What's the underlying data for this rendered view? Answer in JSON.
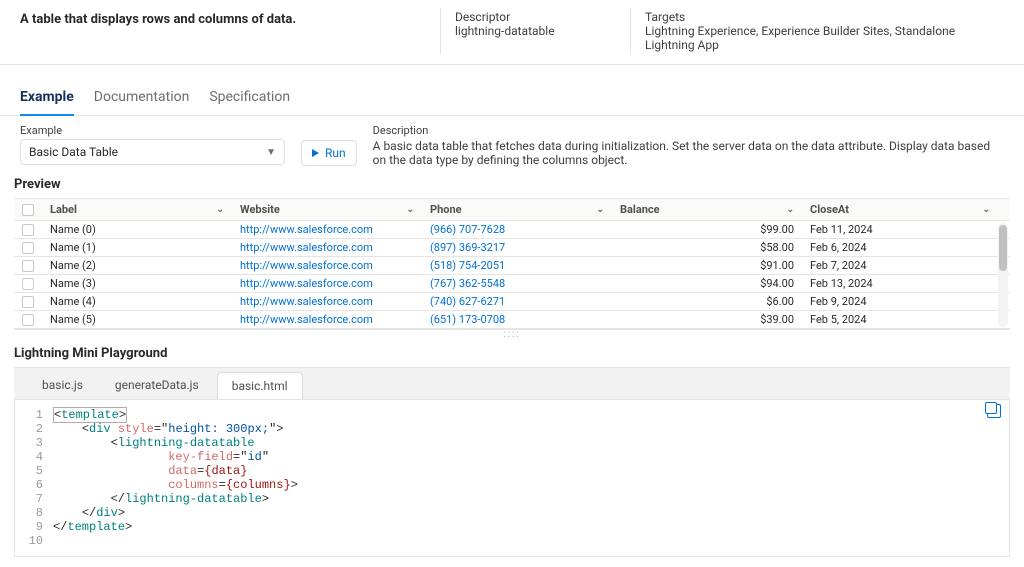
{
  "meta": {
    "summary": "A table that displays rows and columns of data.",
    "descriptor_label": "Descriptor",
    "descriptor_value": "lightning-datatable",
    "targets_label": "Targets",
    "targets_value": "Lightning Experience, Experience Builder Sites, Standalone Lightning App"
  },
  "tabs": {
    "example": "Example",
    "documentation": "Documentation",
    "specification": "Specification"
  },
  "example": {
    "label": "Example",
    "selected": "Basic Data Table",
    "run_label": "Run",
    "desc_label": "Description",
    "desc_text": "A basic data table that fetches data during initialization. Set the server data on the data attribute. Display data based on the data type by defining the columns object."
  },
  "preview_label": "Preview",
  "table": {
    "columns": {
      "label": "Label",
      "website": "Website",
      "phone": "Phone",
      "balance": "Balance",
      "closeat": "CloseAt"
    },
    "rows": [
      {
        "label": "Name (0)",
        "website": "http://www.salesforce.com",
        "phone": "(966) 707-7628",
        "balance": "$99.00",
        "closeat": "Feb 11, 2024"
      },
      {
        "label": "Name (1)",
        "website": "http://www.salesforce.com",
        "phone": "(897) 369-3217",
        "balance": "$58.00",
        "closeat": "Feb 6, 2024"
      },
      {
        "label": "Name (2)",
        "website": "http://www.salesforce.com",
        "phone": "(518) 754-2051",
        "balance": "$91.00",
        "closeat": "Feb 7, 2024"
      },
      {
        "label": "Name (3)",
        "website": "http://www.salesforce.com",
        "phone": "(767) 362-5548",
        "balance": "$94.00",
        "closeat": "Feb 13, 2024"
      },
      {
        "label": "Name (4)",
        "website": "http://www.salesforce.com",
        "phone": "(740) 627-6271",
        "balance": "$6.00",
        "closeat": "Feb 9, 2024"
      },
      {
        "label": "Name (5)",
        "website": "http://www.salesforce.com",
        "phone": "(651) 173-0708",
        "balance": "$39.00",
        "closeat": "Feb 5, 2024"
      }
    ]
  },
  "playground_label": "Lightning Mini Playground",
  "code_tabs": {
    "t0": "basic.js",
    "t1": "generateData.js",
    "t2": "basic.html"
  },
  "code": {
    "l1": {
      "n": "1",
      "a": "<",
      "b": "template",
      "c": ">"
    },
    "l2": {
      "n": "2",
      "indent": "    ",
      "a": "<",
      "b": "div",
      "sp": " ",
      "attr1": "style",
      "eq": "=\"",
      "val1": "height: 300px;",
      "cq": "\">"
    },
    "l3": {
      "n": "3",
      "indent": "        ",
      "a": "<",
      "b": "lightning-datatable"
    },
    "l4": {
      "n": "4",
      "indent": "                ",
      "attr": "key-field",
      "eq": "=\"",
      "val": "id",
      "cq": "\""
    },
    "l5": {
      "n": "5",
      "indent": "                ",
      "attr": "data",
      "eq": "=",
      "ob": "{",
      "val": "data",
      "cb": "}"
    },
    "l6": {
      "n": "6",
      "indent": "                ",
      "attr": "columns",
      "eq": "=",
      "ob": "{",
      "val": "columns",
      "cb": "}",
      "end": ">"
    },
    "l7": {
      "n": "7",
      "indent": "        ",
      "a": "</",
      "b": "lightning-datatable",
      "c": ">"
    },
    "l8": {
      "n": "8",
      "indent": "    ",
      "a": "</",
      "b": "div",
      "c": ">"
    },
    "l9": {
      "n": "9",
      "a": "</",
      "b": "template",
      "c": ">"
    },
    "l10": {
      "n": "10",
      "t": ""
    }
  }
}
